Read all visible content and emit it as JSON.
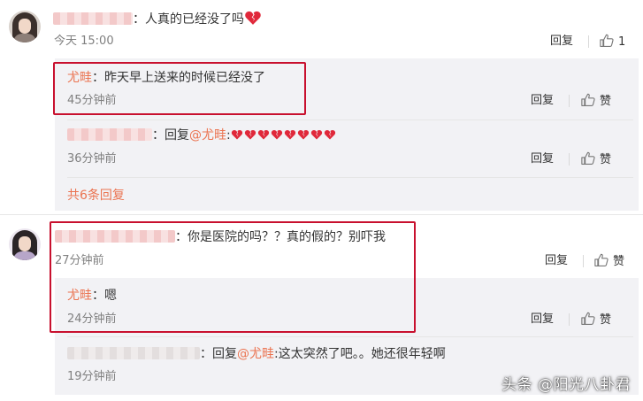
{
  "comments": [
    {
      "text": "：人真的已经没了吗",
      "time": "今天 15:00",
      "reply_label": "回复",
      "like_count": "1",
      "replies": [
        {
          "user": "尤畦",
          "text": "：昨天早上送来的时候已经没了",
          "time": "45分钟前",
          "reply_label": "回复",
          "like_label": "赞"
        },
        {
          "prefix": "：回复",
          "at_user": "@尤畦",
          "text": ":",
          "time": "36分钟前",
          "reply_label": "回复",
          "like_label": "赞"
        }
      ],
      "more_label": "共6条回复"
    },
    {
      "text": "：你是医院的吗？？真的假的？别吓我",
      "time": "27分钟前",
      "reply_label": "回复",
      "like_label": "赞",
      "replies": [
        {
          "user": "尤畦",
          "text": "：嗯",
          "time": "24分钟前",
          "reply_label": "回复",
          "like_label": "赞"
        },
        {
          "prefix": "：回复",
          "at_user": "@尤畦",
          "text": ":这太突然了吧。。她还很年轻啊",
          "time": "19分钟前"
        }
      ]
    }
  ],
  "watermark": "头条 @阳光八卦君",
  "colors": {
    "username": "#eb7350",
    "highlight_box": "#c8102e",
    "sub_bg": "#f2f2f5",
    "heart": "#e0283a"
  },
  "icons": [
    "broken-heart-icon",
    "thumb-up-icon"
  ]
}
